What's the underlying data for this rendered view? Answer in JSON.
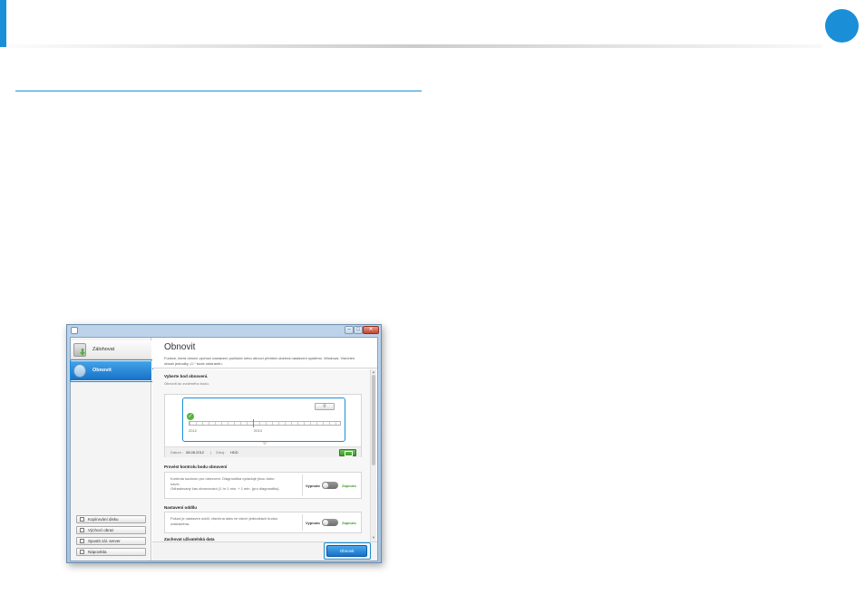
{
  "colors": {
    "accent": "#1a8fd8",
    "success": "#3c9a2b"
  },
  "window": {
    "controls": {
      "minimize_icon": "minimize-icon",
      "maximize_icon": "maximize-icon",
      "close_icon": "close-icon"
    },
    "sidebar": {
      "items": [
        {
          "label": "Zálohovat",
          "icon": "backup-icon",
          "selected": false
        },
        {
          "label": "Obnovit",
          "icon": "restore-icon",
          "selected": true
        }
      ],
      "buttons": [
        {
          "label": "Kopírování disku",
          "icon": "disk-copy-icon"
        },
        {
          "label": "Výchozí obraz",
          "icon": "default-image-icon"
        },
        {
          "label": "Spustit zál. server",
          "icon": "server-icon"
        },
        {
          "label": "Nápověda",
          "icon": "help-icon"
        }
      ]
    },
    "main": {
      "title": "Obnovit",
      "description": "Funkce, která obnoví výchozí nastavení počítače nebo obnoví přehled uložená nastavení systému. Windows. Všechen obsah jednotky „C:“ bude odstraněn.",
      "timeline_section": {
        "heading": "Vyberte bod obnovení.",
        "subheading": "Obnovit do zvoleného bodu.",
        "zoom_icon": "zoom-icon",
        "years": [
          "2012",
          "2013"
        ],
        "date_label": "Datum :",
        "date_value": "08.08.2012",
        "separator": "|",
        "drive_label": "Zdroj :",
        "drive_value": "HDD"
      },
      "check_section": {
        "heading": "Provést kontrolu bodu obnovení",
        "text_line1": "Kontrola souboru pro obnovení. Diagnostika vyžaduje jinou dobu",
        "text_line2": "navíc.",
        "text_line3": "Odhadovaný čas obnovování (1 hr 1 min. + 1 min. (pro diagnostiku).",
        "off_label": "Vypnuto",
        "on_label": "Zapnuto",
        "toggle_state": "off"
      },
      "partition_section": {
        "heading": "Nastavení oddílu",
        "text_line1": "Pokud je nastaven oddíl, všechna data ve všech jednotkách budou",
        "text_line2": "odstraněna.",
        "off_label": "Vypnuto",
        "on_label": "Zapnuto",
        "toggle_state": "off"
      },
      "keep_section": {
        "heading": "Zachovat uživatelská data"
      },
      "restore_button": "Obnovit"
    }
  }
}
